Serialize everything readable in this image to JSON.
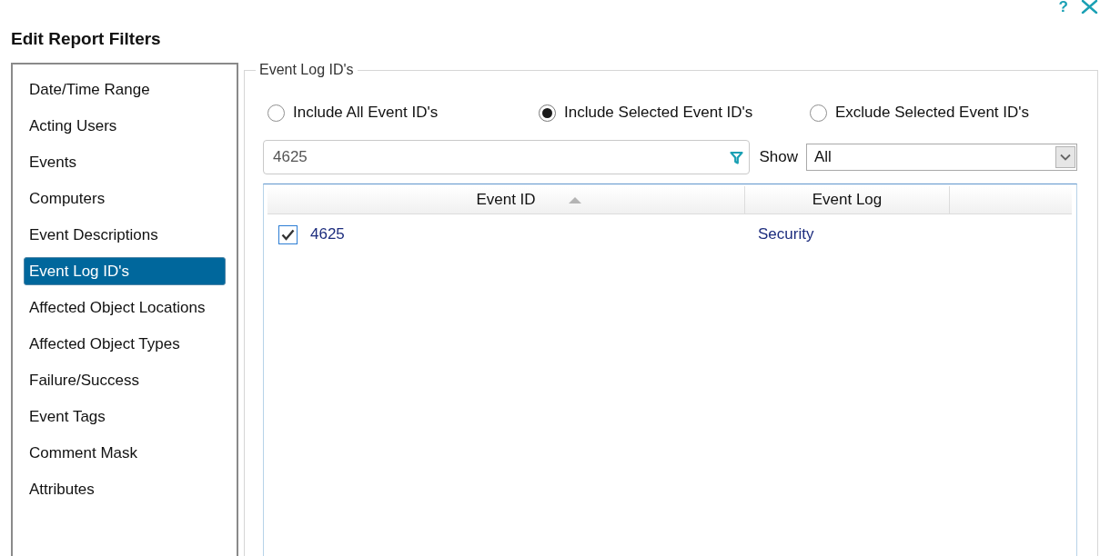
{
  "window": {
    "title": "Edit Report Filters",
    "help": "?"
  },
  "sidebar": {
    "items": [
      {
        "label": "Date/Time Range",
        "selected": false
      },
      {
        "label": "Acting Users",
        "selected": false
      },
      {
        "label": "Events",
        "selected": false
      },
      {
        "label": "Computers",
        "selected": false
      },
      {
        "label": "Event Descriptions",
        "selected": false
      },
      {
        "label": "Event Log ID's",
        "selected": true
      },
      {
        "label": "Affected Object Locations",
        "selected": false
      },
      {
        "label": "Affected Object Types",
        "selected": false
      },
      {
        "label": "Failure/Success",
        "selected": false
      },
      {
        "label": "Event Tags",
        "selected": false
      },
      {
        "label": "Comment Mask",
        "selected": false
      },
      {
        "label": "Attributes",
        "selected": false
      }
    ]
  },
  "panel": {
    "legend": "Event Log ID's",
    "options": [
      {
        "label": "Include All Event ID's",
        "selected": false
      },
      {
        "label": "Include Selected Event ID's",
        "selected": true
      },
      {
        "label": "Exclude Selected Event ID's",
        "selected": false
      }
    ],
    "filter": {
      "value": "4625"
    },
    "show": {
      "label": "Show",
      "value": "All"
    },
    "table": {
      "columns": [
        {
          "label": "Event ID",
          "sorted": true
        },
        {
          "label": "Event Log",
          "sorted": false
        }
      ],
      "rows": [
        {
          "checked": true,
          "cells": [
            "4625",
            "Security"
          ]
        }
      ]
    }
  }
}
